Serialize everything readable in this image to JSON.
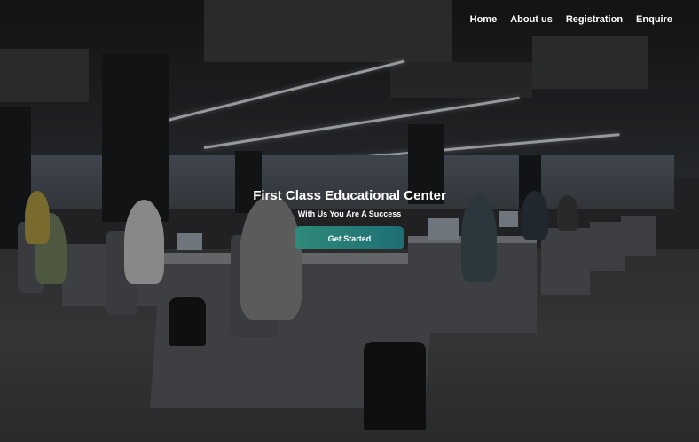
{
  "nav": {
    "items": [
      {
        "label": "Home"
      },
      {
        "label": "About us"
      },
      {
        "label": "Registration"
      },
      {
        "label": "Enquire"
      }
    ]
  },
  "hero": {
    "title": "First Class Educational Center",
    "subtitle": "With Us You Are A Success",
    "cta_label": "Get Started"
  },
  "colors": {
    "cta_start": "#2e8a79",
    "cta_end": "#1e6f74",
    "text": "#ffffff"
  }
}
